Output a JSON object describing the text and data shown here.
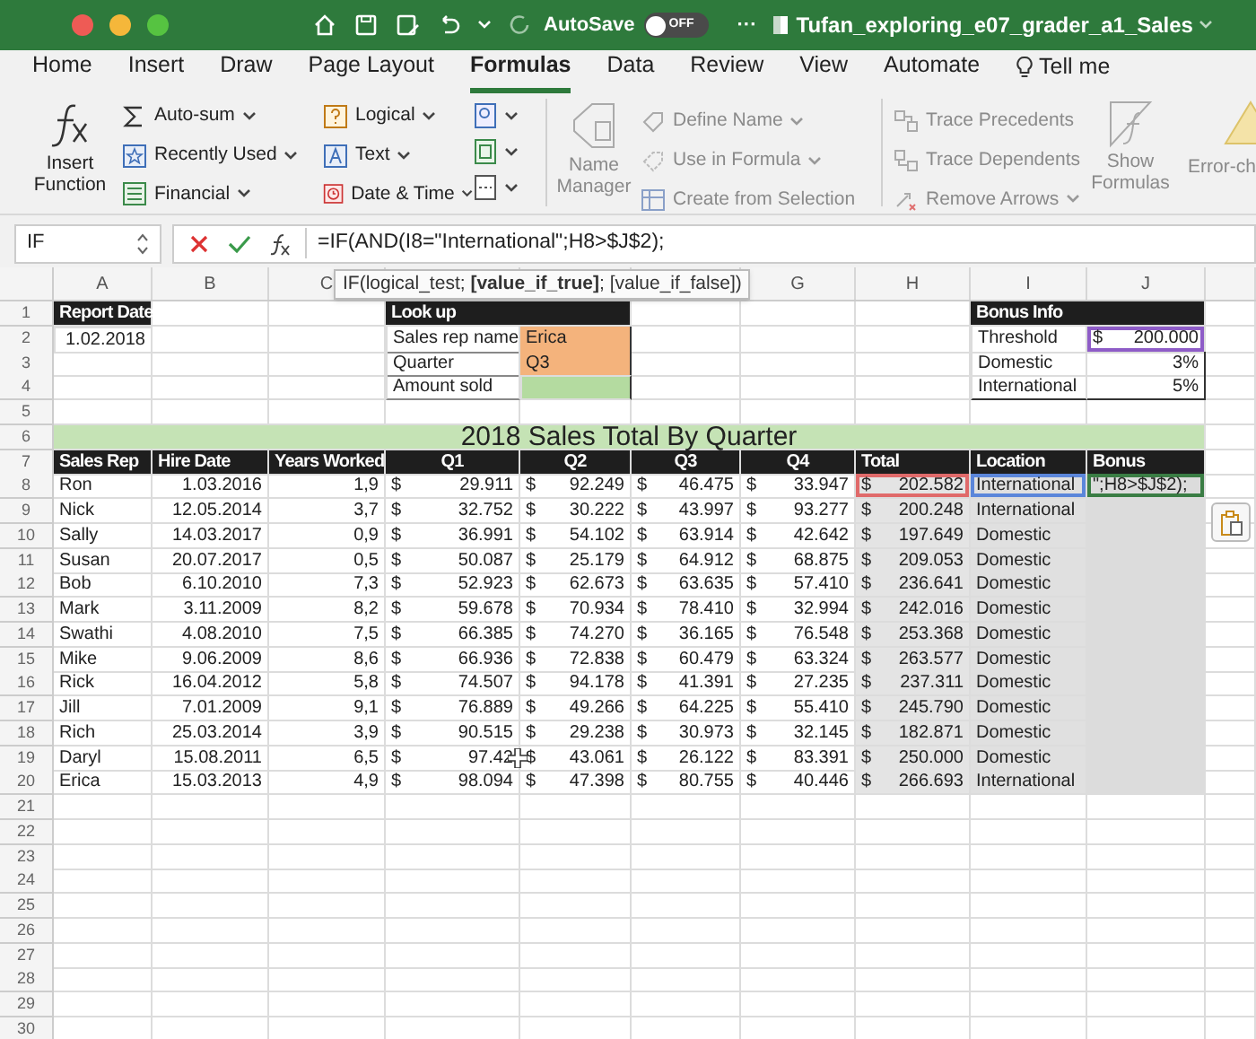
{
  "title_bar": {
    "autosave_label": "AutoSave",
    "autosave_state": "OFF",
    "autosave_on": false,
    "more": "···",
    "document_title": "Tufan_exploring_e07_grader_a1_Sales"
  },
  "tabs": [
    {
      "label": "Home",
      "selected": false
    },
    {
      "label": "Insert",
      "selected": false
    },
    {
      "label": "Draw",
      "selected": false
    },
    {
      "label": "Page Layout",
      "selected": false
    },
    {
      "label": "Formulas",
      "selected": true
    },
    {
      "label": "Data",
      "selected": false
    },
    {
      "label": "Review",
      "selected": false
    },
    {
      "label": "View",
      "selected": false
    },
    {
      "label": "Automate",
      "selected": false
    }
  ],
  "tell_me": "Tell me",
  "ribbon": {
    "insert_function": "Insert Function",
    "function_library": [
      {
        "label": "Auto-sum",
        "menu": true
      },
      {
        "label": "Recently Used",
        "menu": true
      },
      {
        "label": "Financial",
        "menu": true
      },
      {
        "label": "Logical",
        "menu": true
      },
      {
        "label": "Text",
        "menu": true
      },
      {
        "label": "Date & Time",
        "menu": true
      }
    ],
    "name_manager": {
      "label": "Name Manager",
      "disabled": true
    },
    "defined_names": [
      {
        "label": "Define Name",
        "menu": true,
        "disabled": true
      },
      {
        "label": "Use in Formula",
        "menu": true,
        "disabled": true
      },
      {
        "label": "Create from Selection",
        "menu": false,
        "disabled": true
      }
    ],
    "auditing": [
      {
        "label": "Trace Precedents",
        "menu": false,
        "disabled": true
      },
      {
        "label": "Trace Dependents",
        "menu": false,
        "disabled": true
      },
      {
        "label": "Remove Arrows",
        "menu": true,
        "disabled": true
      }
    ],
    "show_formulas": {
      "label": "Show Formulas",
      "disabled": true
    },
    "error_checking": {
      "label": "Error-ch",
      "disabled": true
    }
  },
  "formula_bar": {
    "name_box": "IF",
    "formula": "=IF(AND(I8=\"International\";H8>$J$2);",
    "tooltip": "IF(logical_test; **[value_if_true]**; [value_if_false])"
  },
  "column_headers": {
    "left": [
      "A",
      "B",
      "C"
    ],
    "right": [
      "G",
      "H",
      "I",
      "J"
    ]
  },
  "row_numbers": [
    "1",
    "2",
    "3",
    "4",
    "5",
    "6",
    "7",
    "8",
    "9",
    "10",
    "11",
    "12",
    "13",
    "14",
    "15",
    "16",
    "17",
    "18",
    "19",
    "20",
    "21",
    "22",
    "23",
    "24",
    "25",
    "26",
    "27",
    "28",
    "29",
    "30"
  ],
  "report_date": {
    "label": "Report Date",
    "value": "1.02.2018"
  },
  "lookup": {
    "title": "Look up",
    "rows": [
      {
        "label": "Sales rep name",
        "value": "Erica",
        "kind": "input"
      },
      {
        "label": "Quarter",
        "value": "Q3",
        "kind": "input"
      },
      {
        "label": "Amount sold",
        "kind": "result"
      }
    ]
  },
  "bonus_info": {
    "title": "Bonus Info",
    "threshold": {
      "label": "Threshold",
      "currency": "$",
      "value": "200.000",
      "referenced": true
    },
    "rates": [
      {
        "label": "Domestic",
        "value": "3%"
      },
      {
        "label": "International",
        "value": "5%"
      }
    ]
  },
  "banner": "2018 Sales Total By Quarter",
  "sales_table": {
    "columns": [
      "Sales Rep",
      "Hire Date",
      "Years Worked",
      "Q1",
      "Q2",
      "Q3",
      "Q4",
      "Total",
      "Location",
      "Bonus"
    ],
    "rows": [
      {
        "rep": "Ron",
        "hire_date": "1.03.2016",
        "years": "1,9",
        "quarters": [
          [
            "$",
            "29.911"
          ],
          [
            "$",
            "92.249"
          ],
          [
            "$",
            "46.475"
          ],
          [
            "$",
            "33.947"
          ]
        ],
        "total": [
          "$",
          "202.582"
        ],
        "location": "International",
        "referenced": true,
        "bonus": "\";H8>$J$2);",
        "editing": true
      },
      {
        "rep": "Nick",
        "hire_date": "12.05.2014",
        "years": "3,7",
        "quarters": [
          [
            "$",
            "32.752"
          ],
          [
            "$",
            "30.222"
          ],
          [
            "$",
            "43.997"
          ],
          [
            "$",
            "93.277"
          ]
        ],
        "total": [
          "$",
          "200.248"
        ],
        "location": "International",
        "referenced": false,
        "editing": false
      },
      {
        "rep": "Sally",
        "hire_date": "14.03.2017",
        "years": "0,9",
        "quarters": [
          [
            "$",
            "36.991"
          ],
          [
            "$",
            "54.102"
          ],
          [
            "$",
            "63.914"
          ],
          [
            "$",
            "42.642"
          ]
        ],
        "total": [
          "$",
          "197.649"
        ],
        "location": "Domestic",
        "referenced": false,
        "editing": false
      },
      {
        "rep": "Susan",
        "hire_date": "20.07.2017",
        "years": "0,5",
        "quarters": [
          [
            "$",
            "50.087"
          ],
          [
            "$",
            "25.179"
          ],
          [
            "$",
            "64.912"
          ],
          [
            "$",
            "68.875"
          ]
        ],
        "total": [
          "$",
          "209.053"
        ],
        "location": "Domestic",
        "referenced": false,
        "editing": false
      },
      {
        "rep": "Bob",
        "hire_date": "6.10.2010",
        "years": "7,3",
        "quarters": [
          [
            "$",
            "52.923"
          ],
          [
            "$",
            "62.673"
          ],
          [
            "$",
            "63.635"
          ],
          [
            "$",
            "57.410"
          ]
        ],
        "total": [
          "$",
          "236.641"
        ],
        "location": "Domestic",
        "referenced": false,
        "editing": false
      },
      {
        "rep": "Mark",
        "hire_date": "3.11.2009",
        "years": "8,2",
        "quarters": [
          [
            "$",
            "59.678"
          ],
          [
            "$",
            "70.934"
          ],
          [
            "$",
            "78.410"
          ],
          [
            "$",
            "32.994"
          ]
        ],
        "total": [
          "$",
          "242.016"
        ],
        "location": "Domestic",
        "referenced": false,
        "editing": false
      },
      {
        "rep": "Swathi",
        "hire_date": "4.08.2010",
        "years": "7,5",
        "quarters": [
          [
            "$",
            "66.385"
          ],
          [
            "$",
            "74.270"
          ],
          [
            "$",
            "36.165"
          ],
          [
            "$",
            "76.548"
          ]
        ],
        "total": [
          "$",
          "253.368"
        ],
        "location": "Domestic",
        "referenced": false,
        "editing": false
      },
      {
        "rep": "Mike",
        "hire_date": "9.06.2009",
        "years": "8,6",
        "quarters": [
          [
            "$",
            "66.936"
          ],
          [
            "$",
            "72.838"
          ],
          [
            "$",
            "60.479"
          ],
          [
            "$",
            "63.324"
          ]
        ],
        "total": [
          "$",
          "263.577"
        ],
        "location": "Domestic",
        "referenced": false,
        "editing": false
      },
      {
        "rep": "Rick",
        "hire_date": "16.04.2012",
        "years": "5,8",
        "quarters": [
          [
            "$",
            "74.507"
          ],
          [
            "$",
            "94.178"
          ],
          [
            "$",
            "41.391"
          ],
          [
            "$",
            "27.235"
          ]
        ],
        "total": [
          "$",
          "237.311"
        ],
        "location": "Domestic",
        "referenced": false,
        "editing": false
      },
      {
        "rep": "Jill",
        "hire_date": "7.01.2009",
        "years": "9,1",
        "quarters": [
          [
            "$",
            "76.889"
          ],
          [
            "$",
            "49.266"
          ],
          [
            "$",
            "64.225"
          ],
          [
            "$",
            "55.410"
          ]
        ],
        "total": [
          "$",
          "245.790"
        ],
        "location": "Domestic",
        "referenced": false,
        "editing": false
      },
      {
        "rep": "Rich",
        "hire_date": "25.03.2014",
        "years": "3,9",
        "quarters": [
          [
            "$",
            "90.515"
          ],
          [
            "$",
            "29.238"
          ],
          [
            "$",
            "30.973"
          ],
          [
            "$",
            "32.145"
          ]
        ],
        "total": [
          "$",
          "182.871"
        ],
        "location": "Domestic",
        "referenced": false,
        "editing": false
      },
      {
        "rep": "Daryl",
        "hire_date": "15.08.2011",
        "years": "6,5",
        "quarters": [
          [
            "$",
            "97.42"
          ],
          [
            "$",
            "43.061"
          ],
          [
            "$",
            "26.122"
          ],
          [
            "$",
            "83.391"
          ]
        ],
        "total": [
          "$",
          "250.000"
        ],
        "location": "Domestic",
        "referenced": false,
        "editing": false
      },
      {
        "rep": "Erica",
        "hire_date": "15.03.2013",
        "years": "4,9",
        "quarters": [
          [
            "$",
            "98.094"
          ],
          [
            "$",
            "47.398"
          ],
          [
            "$",
            "80.755"
          ],
          [
            "$",
            "40.446"
          ]
        ],
        "total": [
          "$",
          "266.693"
        ],
        "location": "International",
        "referenced": false,
        "editing": false
      }
    ]
  }
}
